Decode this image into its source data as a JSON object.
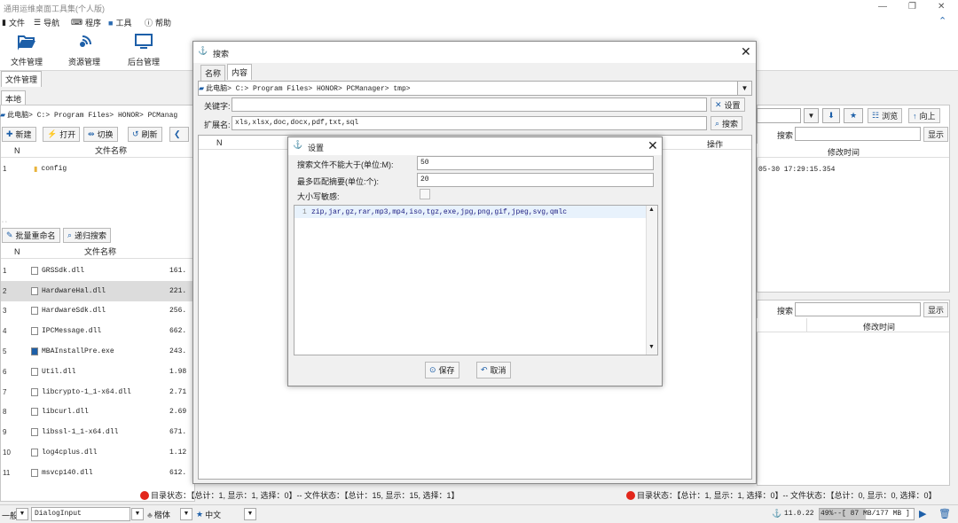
{
  "app": {
    "title": "通用运维桌面工具集(个人版)"
  },
  "menu": {
    "file": "文件",
    "nav": "导航",
    "program": "程序",
    "tools": "工具",
    "help": "帮助"
  },
  "ribbon": {
    "file_mgmt": "文件管理",
    "resource_mgmt": "资源管理",
    "backend_mgmt": "后台管理"
  },
  "main_tab": "文件管理",
  "left": {
    "local_tab": "本地",
    "breadcrumb": "此电脑> C:> Program Files> HONOR> PCManag",
    "buttons": {
      "new": "新建",
      "open": "打开",
      "switch": "切换",
      "refresh": "刷新"
    },
    "top_cols": {
      "n": "N",
      "name": "文件名称"
    },
    "top_rows": [
      {
        "n": "1",
        "name": "config"
      }
    ],
    "batch_rename": "批量重命名",
    "recursive_search": "递归搜索",
    "rows": [
      {
        "n": "1",
        "name": "GRSSdk.dll",
        "size": "161."
      },
      {
        "n": "2",
        "name": "HardwareHal.dll",
        "size": "221."
      },
      {
        "n": "3",
        "name": "HardwareSdk.dll",
        "size": "256."
      },
      {
        "n": "4",
        "name": "IPCMessage.dll",
        "size": "662."
      },
      {
        "n": "5",
        "name": "MBAInstallPre.exe",
        "size": "243."
      },
      {
        "n": "6",
        "name": "Util.dll",
        "size": "1.98"
      },
      {
        "n": "7",
        "name": "libcrypto-1_1-x64.dll",
        "size": "2.71"
      },
      {
        "n": "8",
        "name": "libcurl.dll",
        "size": "2.69"
      },
      {
        "n": "9",
        "name": "libssl-1_1-x64.dll",
        "size": "671."
      },
      {
        "n": "10",
        "name": "log4cplus.dll",
        "size": "1.12"
      },
      {
        "n": "11",
        "name": "msvcp140.dll",
        "size": "612."
      }
    ],
    "status": "目录状态：【总计：1, 显示：1, 选择：0】-- 文件状态：【总计：15, 显示：15, 选择：1】"
  },
  "right": {
    "browse": "浏览",
    "up": "向上",
    "search_label": "搜索",
    "show": "显示",
    "mod_time": "修改时间",
    "time1": "05-30 17:29:15.354",
    "status": "目录状态：【总计：1, 显示：1, 选择：0】-- 文件状态：【总计：0, 显示：0, 选择：0】"
  },
  "search_dialog": {
    "title": "搜索",
    "tabs": [
      "名称",
      "内容"
    ],
    "path": "此电脑> C:> Program Files> HONOR> PCManager> tmp>",
    "keyword_label": "关键字:",
    "keyword_value": "",
    "ext_label": "扩展名:",
    "ext_value": "xls,xlsx,doc,docx,pdf,txt,sql",
    "settings_btn": "设置",
    "search_btn": "搜索",
    "col_n": "N",
    "col_op": "操作"
  },
  "settings_dialog": {
    "title": "设置",
    "max_size_label": "搜索文件不能大于(单位:M):",
    "max_size": "50",
    "max_summary_label": "最多匹配摘要(单位:个):",
    "max_summary": "20",
    "case_label": "大小写敏感:",
    "line_no": "1",
    "exclude": "zip,jar,gz,rar,mp3,mp4,iso,tgz,exe,jpg,png,gif,jpeg,svg,qmlc",
    "save": "保存",
    "cancel": "取消"
  },
  "bottom": {
    "general": "一般",
    "dialog_input": "DialogInput",
    "style": "楷体",
    "lang": "中文",
    "version": "11.0.22",
    "memory": "49%--[ 87 MB/177 MB ]"
  }
}
